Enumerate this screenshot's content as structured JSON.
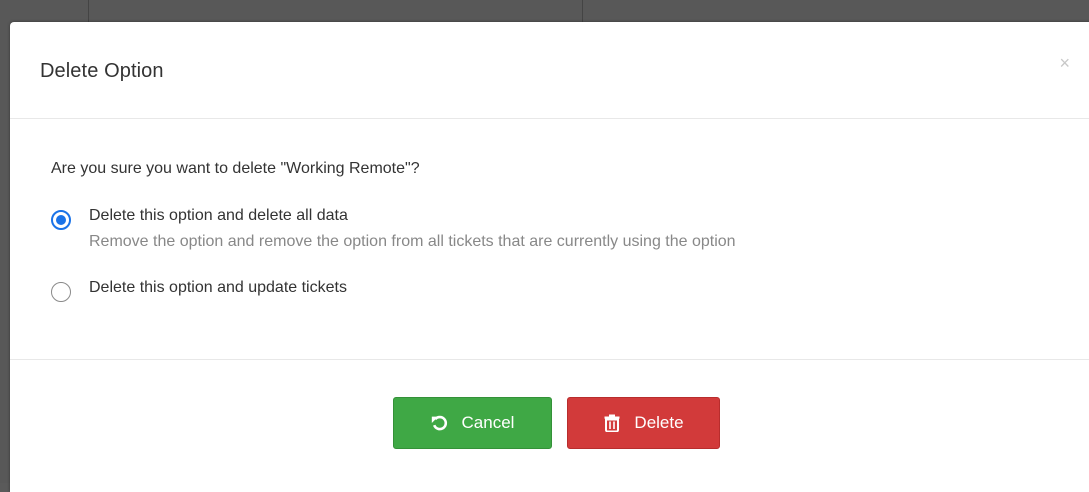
{
  "dialog": {
    "title": "Delete Option",
    "close_label": "×",
    "question": "Are you sure you want to delete \"Working Remote\"?",
    "options": [
      {
        "label": "Delete this option and delete all data",
        "description": "Remove the option and remove the option from all tickets that are currently using the option",
        "selected": true
      },
      {
        "label": "Delete this option and update tickets",
        "selected": false
      }
    ],
    "buttons": {
      "cancel_label": "Cancel",
      "delete_label": "Delete",
      "cancel_icon": "undo-icon",
      "delete_icon": "trash-icon"
    }
  },
  "colors": {
    "cancel": "#3fa845",
    "delete": "#d23a3a",
    "radio_selected": "#1a73e8"
  }
}
